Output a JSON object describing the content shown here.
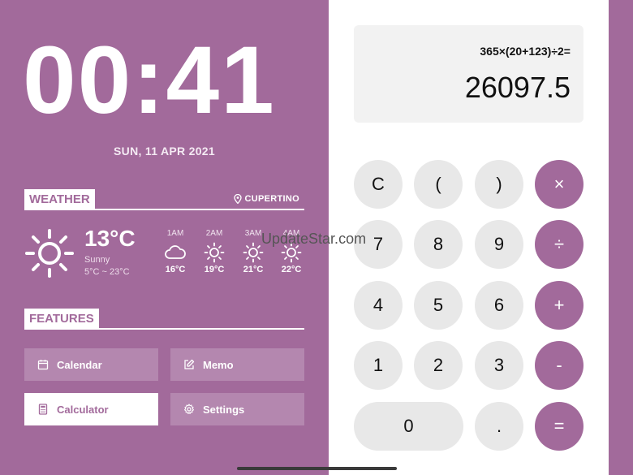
{
  "clock": {
    "time": "00:41",
    "date": "SUN, 11 APR 2021"
  },
  "weather": {
    "section_title": "WEATHER",
    "location": "CUPERTINO",
    "current": {
      "icon": "sun-icon",
      "temp": "13°C",
      "condition": "Sunny",
      "range": "5°C ~ 23°C"
    },
    "hourly": [
      {
        "time": "1AM",
        "icon": "cloud-icon",
        "temp": "16°C"
      },
      {
        "time": "2AM",
        "icon": "sun-icon",
        "temp": "19°C"
      },
      {
        "time": "3AM",
        "icon": "sun-icon",
        "temp": "21°C"
      },
      {
        "time": "4AM",
        "icon": "sun-icon",
        "temp": "22°C"
      }
    ]
  },
  "features": {
    "section_title": "FEATURES",
    "items": [
      {
        "label": "Calendar",
        "icon": "calendar-icon",
        "active": false
      },
      {
        "label": "Memo",
        "icon": "edit-icon",
        "active": false
      },
      {
        "label": "Calculator",
        "icon": "calculator-icon",
        "active": true
      },
      {
        "label": "Settings",
        "icon": "gear-icon",
        "active": false
      }
    ]
  },
  "calculator": {
    "expression": "365×(20+123)÷2=",
    "result": "26097.5",
    "keys": {
      "clear": "C",
      "open_paren": "(",
      "close_paren": ")",
      "multiply": "×",
      "seven": "7",
      "eight": "8",
      "nine": "9",
      "divide": "÷",
      "four": "4",
      "five": "5",
      "six": "6",
      "plus": "+",
      "one": "1",
      "two": "2",
      "three": "3",
      "minus": "-",
      "zero": "0",
      "dot": ".",
      "equals": "="
    }
  },
  "watermark": "UpdateStar.com",
  "colors": {
    "accent": "#a26a9b",
    "key_bg": "#e8e8e8",
    "display_bg": "#f2f2f2"
  }
}
